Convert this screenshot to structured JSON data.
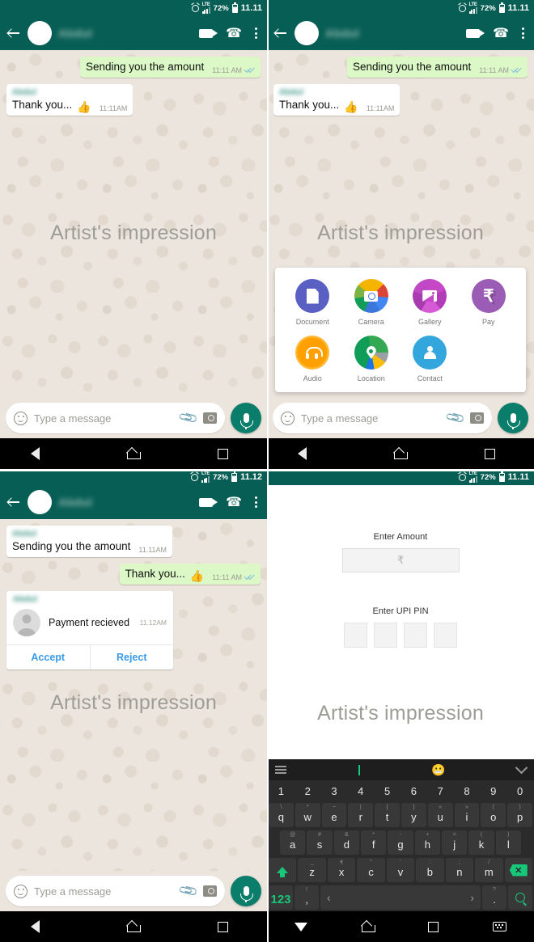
{
  "status_bar": {
    "battery": "72%",
    "network": "LTE",
    "time_a": "11.11",
    "time_b": "11.12"
  },
  "appbar": {
    "contact_name": "Abdul",
    "video_icon": "video-call-icon",
    "call_icon": "phone-call-icon",
    "menu_icon": "overflow-menu-icon"
  },
  "watermark": "Artist's impression",
  "input_bar": {
    "placeholder": "Type a message",
    "emoji_icon": "emoji-icon",
    "attach_icon": "paperclip-icon",
    "camera_icon": "camera-icon",
    "mic_icon": "microphone-icon"
  },
  "panel1": {
    "messages": [
      {
        "dir": "out",
        "text": "Sending you the amount",
        "time": "11:11 AM",
        "ticks": true,
        "sender": "",
        "emoji": ""
      },
      {
        "dir": "in",
        "text": "Thank you...",
        "time": "11:11AM",
        "ticks": false,
        "sender": "Abdul",
        "emoji": "👍"
      }
    ]
  },
  "panel2": {
    "attachments": [
      {
        "label": "Document",
        "icon": "document-icon",
        "color": "#5a5fc4"
      },
      {
        "label": "Camera",
        "icon": "camera-icon",
        "color": "#db4437"
      },
      {
        "label": "Gallery",
        "icon": "gallery-icon",
        "color": "#c648c6"
      },
      {
        "label": "Pay",
        "icon": "pay-rupee-icon",
        "color": "#9b5cb5",
        "glyph": "₹"
      },
      {
        "label": "Audio",
        "icon": "headphones-icon",
        "color": "#ffa000"
      },
      {
        "label": "Location",
        "icon": "map-pin-icon",
        "color": "#0f9d58"
      },
      {
        "label": "Contact",
        "icon": "person-icon",
        "color": "#33a7dd"
      }
    ]
  },
  "panel3": {
    "messages": [
      {
        "dir": "in",
        "text": "Sending you the amount",
        "time": "11.11AM",
        "ticks": false,
        "sender": "Abdul",
        "emoji": ""
      },
      {
        "dir": "out",
        "text": "Thank you...",
        "time": "11:11 AM",
        "ticks": true,
        "sender": "",
        "emoji": "👍"
      }
    ],
    "payment_card": {
      "sender": "Abdul",
      "text": "Payment recieved",
      "time": "11.12AM",
      "accept_label": "Accept",
      "reject_label": "Reject"
    }
  },
  "panel4": {
    "amount_label": "Enter Amount",
    "amount_placeholder": "₹",
    "pin_label": "Enter UPI PIN",
    "pin_boxes": [
      "",
      "",
      "",
      ""
    ],
    "keyboard": {
      "numbers": [
        "1",
        "2",
        "3",
        "4",
        "5",
        "6",
        "7",
        "8",
        "9",
        "0"
      ],
      "row1": [
        {
          "main": "q",
          "alt": "\\"
        },
        {
          "main": "w",
          "alt": "*"
        },
        {
          "main": "e",
          "alt": "~"
        },
        {
          "main": "r",
          "alt": "|"
        },
        {
          "main": "t",
          "alt": "{"
        },
        {
          "main": "y",
          "alt": "}"
        },
        {
          "main": "u",
          "alt": "«"
        },
        {
          "main": "i",
          "alt": "»"
        },
        {
          "main": "o",
          "alt": "("
        },
        {
          "main": "p",
          "alt": ")"
        }
      ],
      "row2": [
        {
          "main": "a",
          "alt": "@"
        },
        {
          "main": "s",
          "alt": "#"
        },
        {
          "main": "d",
          "alt": "&"
        },
        {
          "main": "f",
          "alt": "*"
        },
        {
          "main": "g",
          "alt": "-"
        },
        {
          "main": "h",
          "alt": "+"
        },
        {
          "main": "j",
          "alt": "="
        },
        {
          "main": "k",
          "alt": "("
        },
        {
          "main": "l",
          "alt": ")"
        }
      ],
      "row3": [
        {
          "main": "z",
          "alt": "_"
        },
        {
          "main": "x",
          "alt": "₹"
        },
        {
          "main": "c",
          "alt": "\""
        },
        {
          "main": "v",
          "alt": "'"
        },
        {
          "main": "b",
          "alt": ":"
        },
        {
          "main": "n",
          "alt": ";"
        },
        {
          "main": "m",
          "alt": "/"
        }
      ],
      "numeric_key": "123",
      "comma_key": ",",
      "comma_alt": "!",
      "period_key": ".",
      "period_alt": "?",
      "shift_icon": "shift-icon",
      "delete_icon": "backspace-icon",
      "search_icon": "search-icon",
      "menu_icon": "keyboard-menu-icon",
      "emoji_icon": "emoji-icon",
      "collapse_icon": "chevron-down-icon"
    }
  },
  "navbar": {
    "back": "back-icon",
    "home": "home-icon",
    "recents": "recents-icon",
    "keyboard": "keyboard-icon",
    "down": "hide-keyboard-icon"
  }
}
